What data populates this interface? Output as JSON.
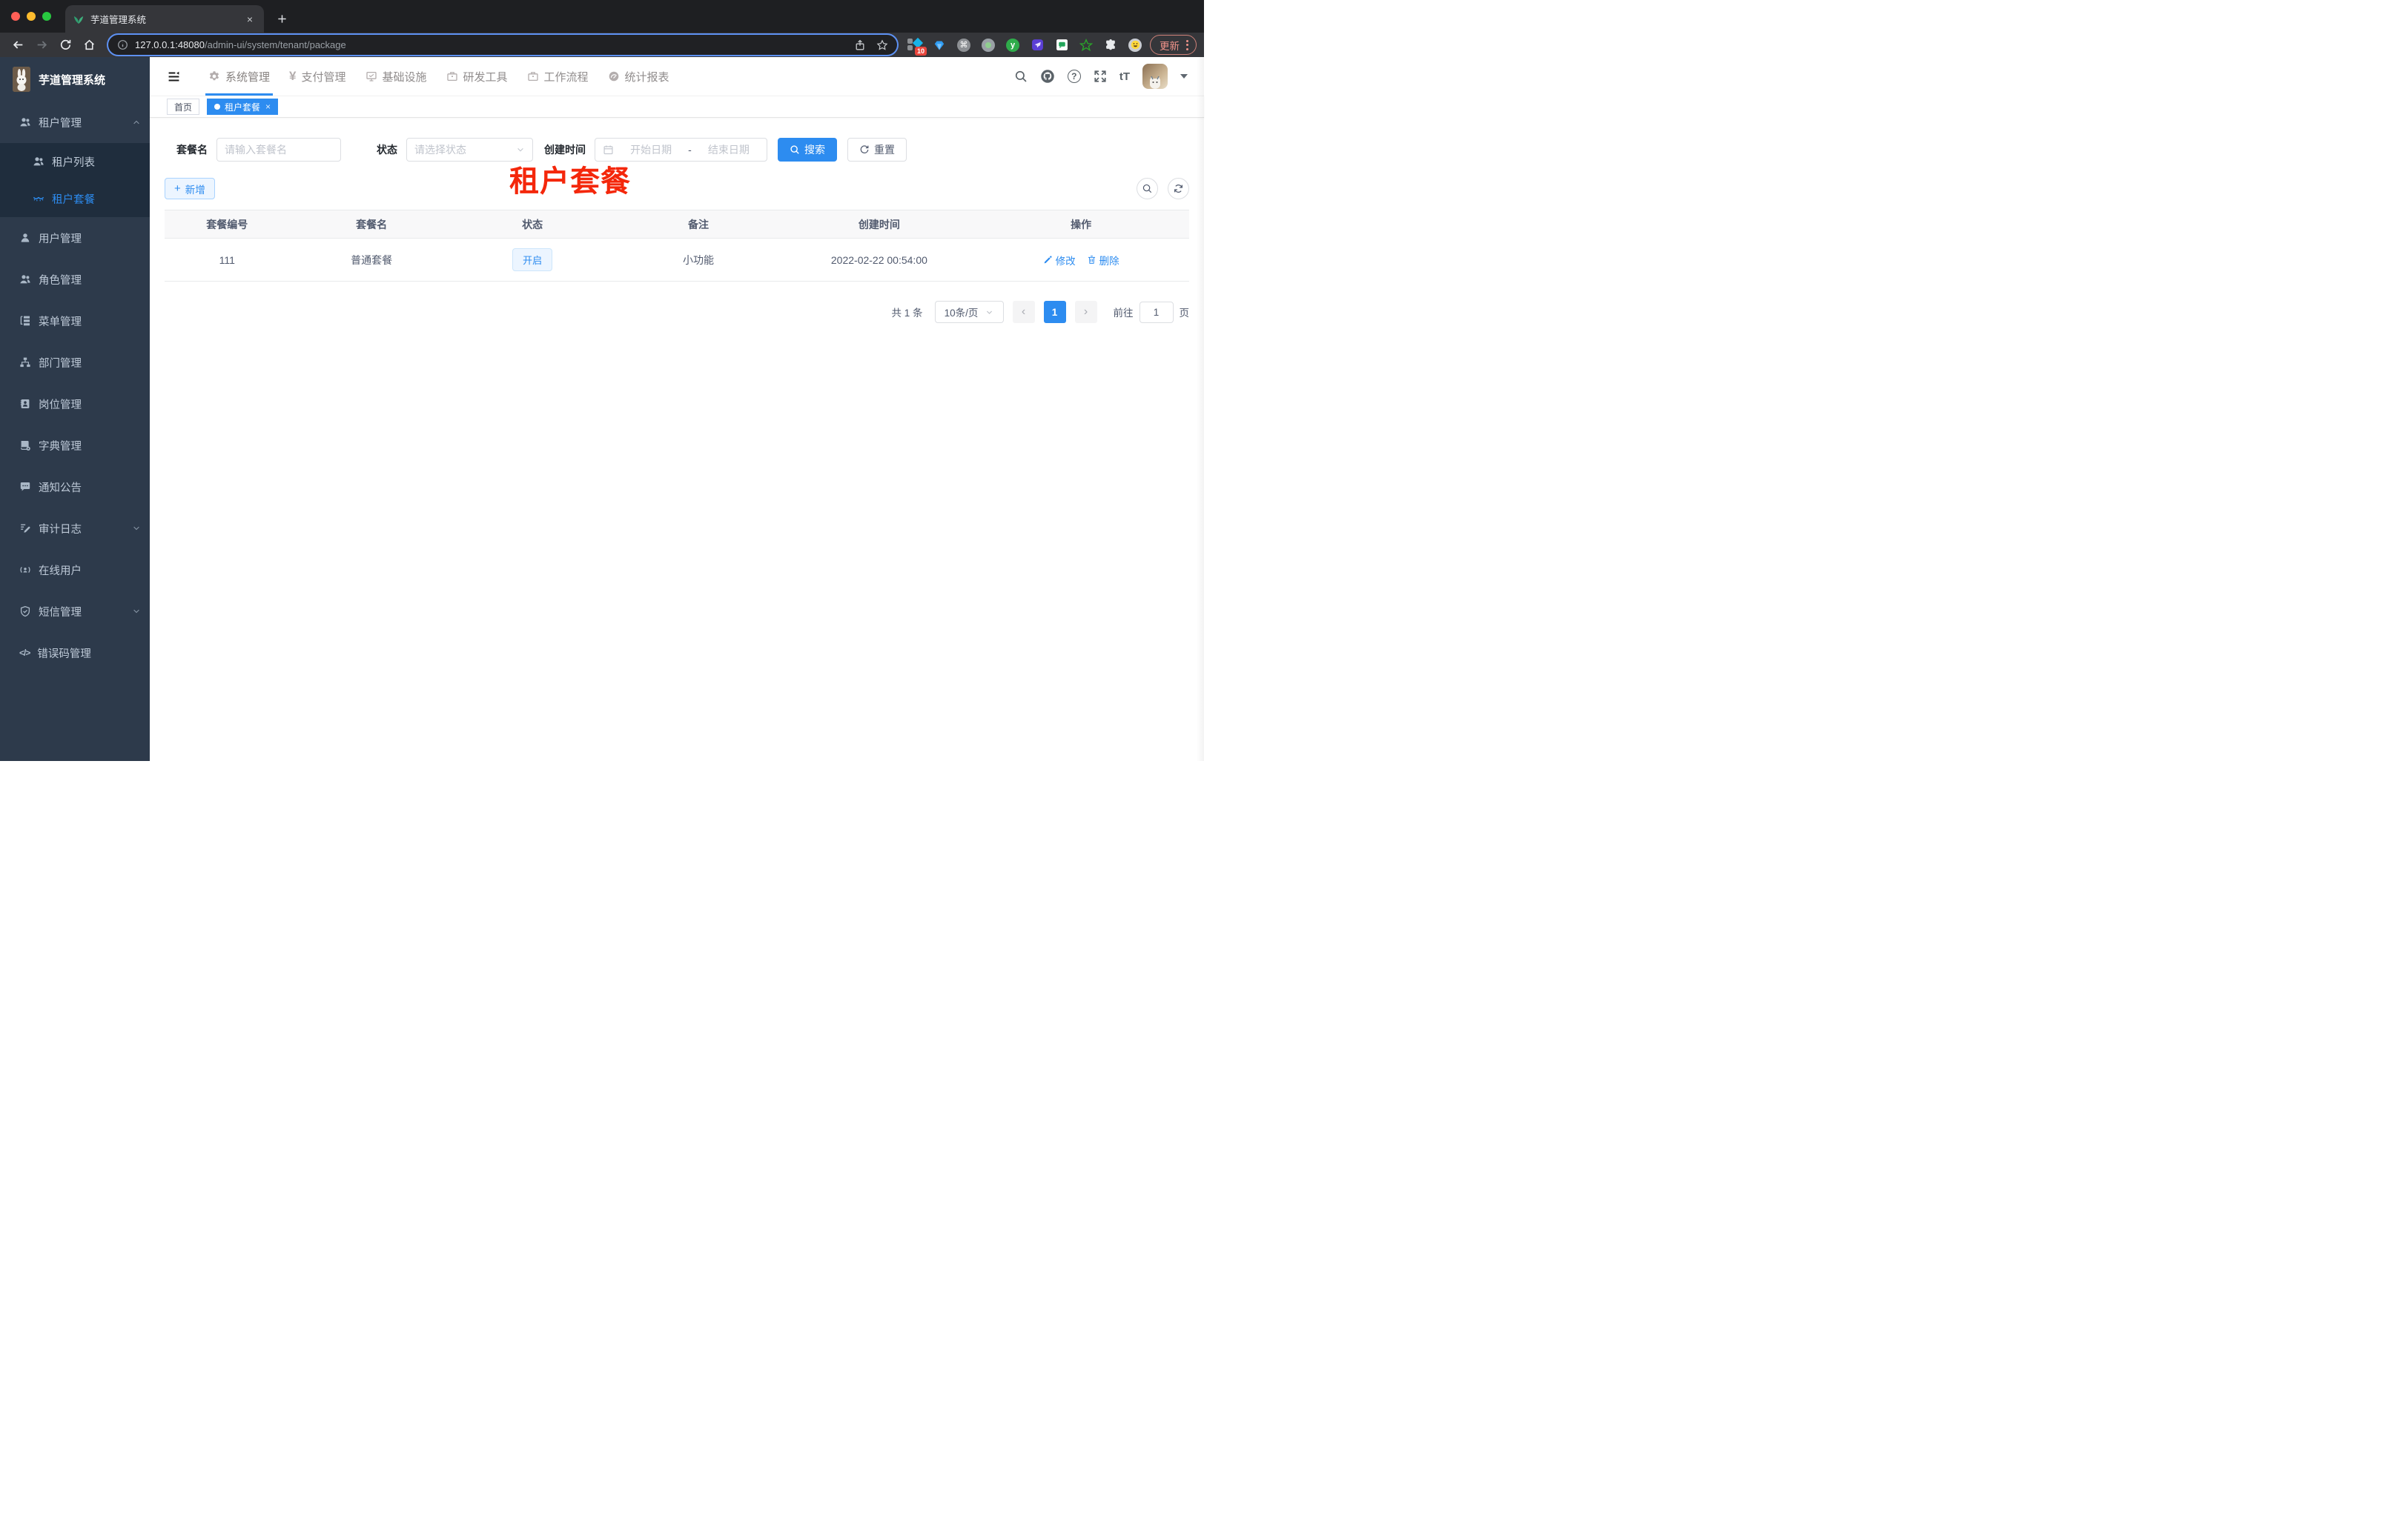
{
  "colors": {
    "primary": "#2d8cf0",
    "annotation_red": "#f4270b",
    "sidebar_bg": "#2d3a4b",
    "submenu_bg": "#1f2d3d",
    "chrome_dark": "#202124",
    "chrome_toolbar": "#35363a",
    "status_tag_bg": "#ecf5ff"
  },
  "browser": {
    "tab_title": "芋道管理系统",
    "url_host": "127.0.0.1:48080",
    "url_path": "/admin-ui/system/tenant/package",
    "update_label": "更新",
    "extension_badge": "10"
  },
  "sidebar": {
    "title": "芋道管理系统",
    "active_item": "租户套餐",
    "menu": [
      {
        "label": "租户管理",
        "children": [
          "租户列表",
          "租户套餐"
        ]
      },
      {
        "label": "用户管理"
      },
      {
        "label": "角色管理"
      },
      {
        "label": "菜单管理"
      },
      {
        "label": "部门管理"
      },
      {
        "label": "岗位管理"
      },
      {
        "label": "字典管理"
      },
      {
        "label": "通知公告"
      },
      {
        "label": "审计日志"
      },
      {
        "label": "在线用户"
      },
      {
        "label": "短信管理"
      },
      {
        "label": "错误码管理"
      }
    ]
  },
  "topnav": {
    "active": "系统管理",
    "items": [
      "系统管理",
      "支付管理",
      "基础设施",
      "研发工具",
      "工作流程",
      "统计报表"
    ]
  },
  "tags": {
    "items": [
      {
        "label": "首页",
        "active": false
      },
      {
        "label": "租户套餐",
        "active": true
      }
    ]
  },
  "annotation": {
    "text": "租户套餐"
  },
  "filters": {
    "name_label": "套餐名",
    "name_placeholder": "请输入套餐名",
    "status_label": "状态",
    "status_placeholder": "请选择状态",
    "date_label": "创建时间",
    "date_start_placeholder": "开始日期",
    "date_separator": "-",
    "date_end_placeholder": "结束日期",
    "search_label": "搜索",
    "reset_label": "重置"
  },
  "toolbar": {
    "add_label": "新增"
  },
  "table": {
    "headers": [
      "套餐编号",
      "套餐名",
      "状态",
      "备注",
      "创建时间",
      "操作"
    ],
    "rows": [
      {
        "id": "111",
        "name": "普通套餐",
        "status": "开启",
        "remark": "小功能",
        "created_at": "2022-02-22 00:54:00",
        "edit_label": "修改",
        "delete_label": "删除"
      }
    ]
  },
  "pagination": {
    "total_text": "共 1 条",
    "page_size_text": "10条/页",
    "current_page": "1",
    "goto_label": "前往",
    "goto_value": "1",
    "page_unit_label": "页"
  },
  "icons": {
    "close_glyph": "×",
    "plus_glyph": "+",
    "yen_glyph": "¥",
    "code_glyph": "</>",
    "font_size_glyph": "tT",
    "question_glyph": "?",
    "chevron_left_glyph": "‹",
    "chevron_right_glyph": "›",
    "command_glyph": "⌘",
    "y_glyph": "y"
  }
}
